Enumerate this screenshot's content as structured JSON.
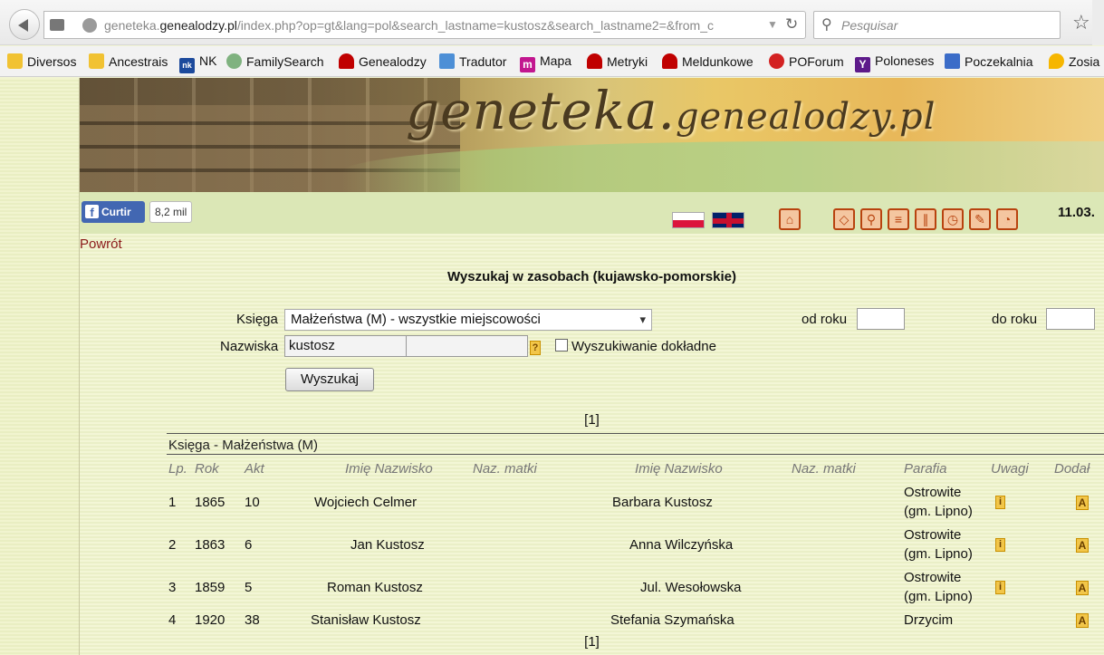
{
  "browser": {
    "url_host_prefix": "geneteka.",
    "url_host": "genealodzy.pl",
    "url_path": "/index.php?op=gt&lang=pol&search_lastname=kustosz&search_lastname2=&from_c",
    "search_placeholder": "Pesquisar"
  },
  "bookmarks": [
    {
      "label": "Diversos",
      "icon": "folder-icon"
    },
    {
      "label": "Ancestrais",
      "icon": "folder-icon"
    },
    {
      "label": "NK",
      "icon": "nk-icon"
    },
    {
      "label": "FamilySearch",
      "icon": "tree-icon"
    },
    {
      "label": "Genealodzy",
      "icon": "ptg-icon"
    },
    {
      "label": "Tradutor",
      "icon": "translate-icon"
    },
    {
      "label": "Mapa",
      "icon": "m-icon"
    },
    {
      "label": "Metryki",
      "icon": "ptg-icon"
    },
    {
      "label": "Meldunkowe",
      "icon": "ptg-icon"
    },
    {
      "label": "POForum",
      "icon": "po-icon"
    },
    {
      "label": "Poloneses",
      "icon": "yahoo-icon"
    },
    {
      "label": "Poczekalnia",
      "icon": "calendar-icon"
    },
    {
      "label": "Zosia",
      "icon": "pin-icon"
    }
  ],
  "banner": {
    "logo_main": "geneteka.",
    "logo_rest": "genealodzy.pl"
  },
  "nav": {
    "fb_label": "Curtir",
    "fb_count": "8,2 mil",
    "date": "11.03."
  },
  "page": {
    "back_link": "Powrót",
    "search_title": "Wyszukaj w zasobach (kujawsko-pomorskie)",
    "form": {
      "ksiega_label": "Księga",
      "ksiega_value": "Małżeństwa (M) - wszystkie miejscowości",
      "od_roku_label": "od roku",
      "od_roku_value": "",
      "do_roku_label": "do roku",
      "do_roku_value": "",
      "nazwiska_label": "Nazwiska",
      "lastname1_value": "kustosz",
      "lastname2_value": "",
      "help_icon": "?",
      "exact_label": "Wyszukiwanie dokładne",
      "submit_label": "Wyszukaj"
    },
    "pager": "[1]",
    "section_title": "Księga - Małżeństwa (M)",
    "table": {
      "headers": [
        "Lp.",
        "Rok",
        "Akt",
        "Imię Nazwisko",
        "Naz. matki",
        "Imię Nazwisko",
        "Naz. matki",
        "Parafia",
        "Uwagi",
        "Dodał"
      ],
      "rows": [
        {
          "lp": "1",
          "rok": "1865",
          "akt": "10",
          "groom": "Wojciech Celmer",
          "bride": "Barbara Kustosz",
          "parish_line1": "Ostrowite",
          "parish_line2": "(gm. Lipno)",
          "has_note": true
        },
        {
          "lp": "2",
          "rok": "1863",
          "akt": "6",
          "groom": "Jan Kustosz",
          "bride": "Anna Wilczyńska",
          "parish_line1": "Ostrowite",
          "parish_line2": "(gm. Lipno)",
          "has_note": true
        },
        {
          "lp": "3",
          "rok": "1859",
          "akt": "5",
          "groom": "Roman Kustosz",
          "bride": "Jul. Wesołowska",
          "parish_line1": "Ostrowite",
          "parish_line2": "(gm. Lipno)",
          "has_note": true
        },
        {
          "lp": "4",
          "rok": "1920",
          "akt": "38",
          "groom": "Stanisław Kustosz",
          "bride": "Stefania Szymańska",
          "parish_line1": "Drzycim",
          "parish_line2": "",
          "has_note": false
        }
      ],
      "note_icon": "i",
      "author_icon": "A"
    }
  }
}
